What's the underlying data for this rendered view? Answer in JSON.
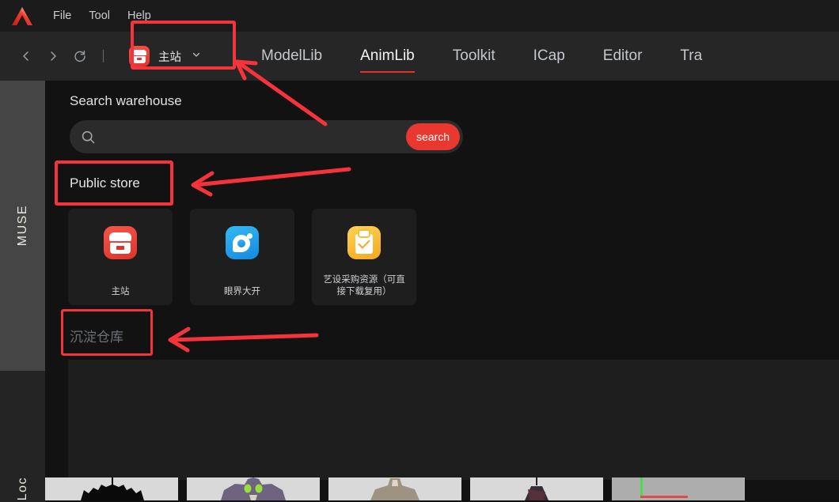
{
  "app": {
    "logo_icon": "muse-logo-icon",
    "menu": [
      {
        "label": "File"
      },
      {
        "label": "Tool"
      },
      {
        "label": "Help"
      }
    ]
  },
  "toolbar": {
    "back_icon": "chevron-left-icon",
    "forward_icon": "chevron-right-icon",
    "refresh_icon": "refresh-icon",
    "site_chip": {
      "icon": "store-icon",
      "label": "主站",
      "dropdown_icon": "chevron-down-icon"
    },
    "tabs": [
      {
        "label": "ModelLib",
        "active": false
      },
      {
        "label": "AnimLib",
        "active": true
      },
      {
        "label": "Toolkit",
        "active": false
      },
      {
        "label": "ICap",
        "active": false
      },
      {
        "label": "Editor",
        "active": false
      },
      {
        "label": "Tra",
        "active": false
      }
    ]
  },
  "rail": {
    "segments": [
      {
        "label": "MUSE",
        "name": "rail-segment-muse"
      },
      {
        "label": "Loc",
        "name": "rail-segment-loc"
      }
    ]
  },
  "main": {
    "section_title": "Search warehouse",
    "search": {
      "icon": "search-icon",
      "value": "",
      "placeholder": "",
      "button_label": "search"
    },
    "groups": [
      {
        "id": "public",
        "label": "Public store"
      },
      {
        "id": "store",
        "label": "沉淀仓库"
      }
    ],
    "cards": [
      {
        "label": "主站",
        "icon": "store-icon",
        "color": "#e0332a"
      },
      {
        "label": "眼界大开",
        "icon": "camera-lens-icon",
        "color": "#1489e0"
      },
      {
        "label": "艺设采购资源（可直接下载复用）",
        "icon": "clipboard-check-icon",
        "color": "#f3a81e"
      }
    ]
  },
  "thumbnails": [
    {
      "name": "thumbnail-bat-creature"
    },
    {
      "name": "thumbnail-green-insect-beast"
    },
    {
      "name": "thumbnail-pale-brute"
    },
    {
      "name": "thumbnail-dark-knight"
    },
    {
      "name": "thumbnail-axis-gizmo"
    }
  ],
  "annotations": {
    "accent_color": "#f5333a",
    "boxes": [
      {
        "name": "annotation-box-site-chip",
        "target": "主站"
      },
      {
        "name": "annotation-box-public-store",
        "target": "Public store"
      },
      {
        "name": "annotation-box-sediment-warehouse",
        "target": "沉淀仓库"
      }
    ],
    "arrows": [
      {
        "name": "annotation-arrow-to-site-chip"
      },
      {
        "name": "annotation-arrow-to-public-store"
      },
      {
        "name": "annotation-arrow-to-sediment-warehouse"
      }
    ]
  }
}
